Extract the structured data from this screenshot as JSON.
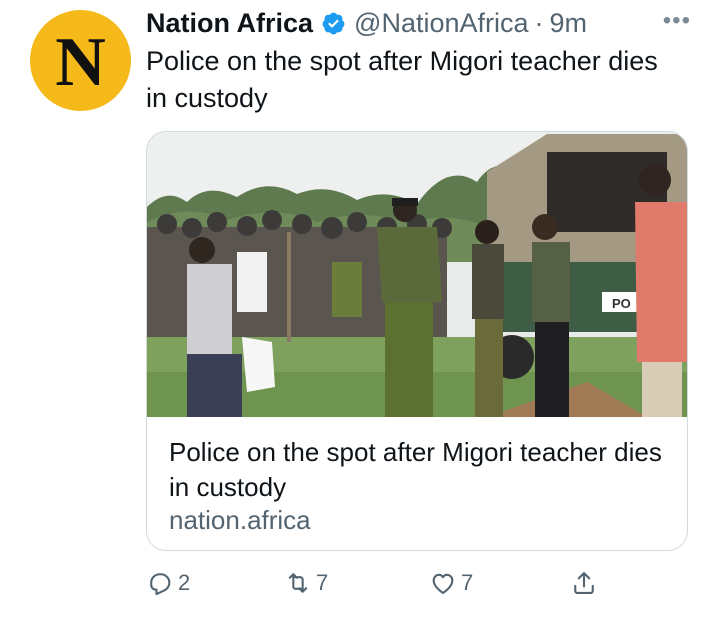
{
  "avatar": {
    "letter": "N",
    "bg": "#f6b91a"
  },
  "header": {
    "name": "Nation Africa",
    "handle": "@NationAfrica",
    "separator": "·",
    "time": "9m",
    "more": "•••"
  },
  "tweet": {
    "text": "Police on the spot after Migori teacher dies in custody"
  },
  "card": {
    "image_text": "PO",
    "title": "Police on the spot after Migori teacher dies in custody",
    "domain": "nation.africa"
  },
  "actions": {
    "reply_count": "2",
    "retweet_count": "7",
    "like_count": "7"
  },
  "colors": {
    "accent": "#1d9bf0",
    "muted": "#536471",
    "border": "#cfd9de"
  }
}
